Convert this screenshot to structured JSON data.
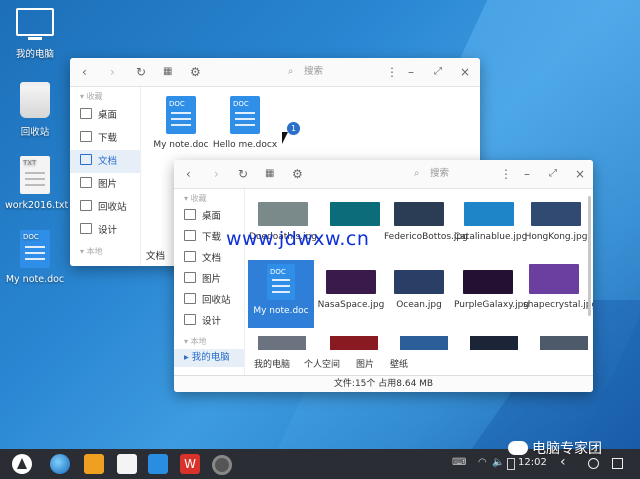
{
  "desktop": {
    "icons": [
      {
        "label": "我的电脑",
        "icon": "monitor-icon"
      },
      {
        "label": "回收站",
        "icon": "trash-icon"
      },
      {
        "label": "work2016.txt",
        "icon": "txt-file-icon",
        "tag": "TXT"
      },
      {
        "label": "My note.doc",
        "icon": "doc-file-icon",
        "tag": "DOC"
      }
    ]
  },
  "window1": {
    "search_placeholder": "搜索",
    "sidebar_header": "收藏",
    "sidebar_items": [
      "桌面",
      "下载",
      "文档",
      "图片",
      "回收站",
      "设计"
    ],
    "sidebar_footer_partial": "本地",
    "files": [
      {
        "name": "My note.doc",
        "tag": "DOC"
      },
      {
        "name": "Hello me.docx",
        "tag": "DOC"
      }
    ],
    "truncated_label": "文档",
    "badge": "1"
  },
  "window2": {
    "search_placeholder": "搜索",
    "sidebar_header": "收藏",
    "sidebar_items": [
      "桌面",
      "下载",
      "文档",
      "图片",
      "回收站",
      "设计"
    ],
    "sidebar_header2": "本地",
    "sidebar_selected": "我的电脑",
    "files": [
      {
        "name": "Doedoathis.jpg",
        "color": "#7a8a8a"
      },
      {
        "name": "",
        "color": "#0b6d7a"
      },
      {
        "name": "FedericoBottos.jpg",
        "color": "#2b3d55"
      },
      {
        "name": "Catalinablue.jpg",
        "color": "#1e86c8"
      },
      {
        "name": "HongKong.jpg",
        "color": "#314a72"
      },
      {
        "name": "My note.doc",
        "color": "#2f8fe8",
        "tag": "DOC"
      },
      {
        "name": "NasaSpace.jpg",
        "color": "#3a1a4a"
      },
      {
        "name": "Ocean.jpg",
        "color": "#2a3f66"
      },
      {
        "name": "PurpleGalaxy.jpg",
        "color": "#241033"
      },
      {
        "name": "shapecrystal.jpg",
        "color": "#6a3fa0"
      }
    ],
    "bottom_row": [
      "我的电脑",
      "个人空间",
      "图片",
      "壁纸"
    ],
    "status": "文件:15个 占用8.64 MB"
  },
  "watermark": "www.jdwxw.cn",
  "taskbar": {
    "clock": "12:02",
    "brand": "电脑专家团"
  }
}
